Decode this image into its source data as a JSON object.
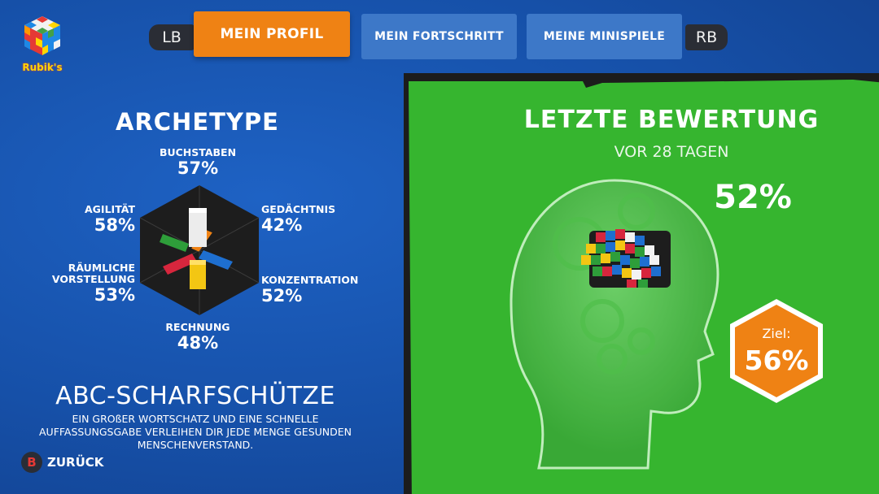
{
  "header": {
    "logo_text": "Rubik's",
    "left_bumper": "LB",
    "right_bumper": "RB",
    "tabs": [
      {
        "label": "MEIN PROFIL",
        "active": true
      },
      {
        "label": "MEIN FORTSCHRITT",
        "active": false
      },
      {
        "label": "MEINE MINISPIELE",
        "active": false
      }
    ]
  },
  "archetype": {
    "title": "ARCHETYPE",
    "stats": {
      "top": {
        "label": "BUCHSTABEN",
        "value": "57%"
      },
      "left_top": {
        "label": "AGILITÄT",
        "value": "58%"
      },
      "right_top": {
        "label": "GEDÄCHTNIS",
        "value": "42%"
      },
      "left_bottom": {
        "label": "RÄUMLICHE VORSTELLUNG",
        "value": "53%"
      },
      "right_bottom": {
        "label": "KONZENTRATION",
        "value": "52%"
      },
      "bottom": {
        "label": "RECHNUNG",
        "value": "48%"
      }
    },
    "name": "ABC-SCHARFSCHÜTZE",
    "description": "EIN GROßER WORTSCHATZ UND EINE SCHNELLE AUFFASSUNGSGABE VERLEIHEN DIR JEDE MENGE GESUNDEN MENSCHENVERSTAND."
  },
  "footer": {
    "back_button": "B",
    "back_label": "ZURÜCK"
  },
  "assessment": {
    "title": "LETZTE BEWERTUNG",
    "subtitle": "VOR 28 TAGEN",
    "score": "52%",
    "goal_label": "Ziel:",
    "goal_value": "56%"
  },
  "colors": {
    "background_blue": "#1650a8",
    "tab_active": "#ef8214",
    "tab_inactive": "#3d78c8",
    "panel_green": "#36b52f",
    "goal_orange": "#ef8214"
  }
}
